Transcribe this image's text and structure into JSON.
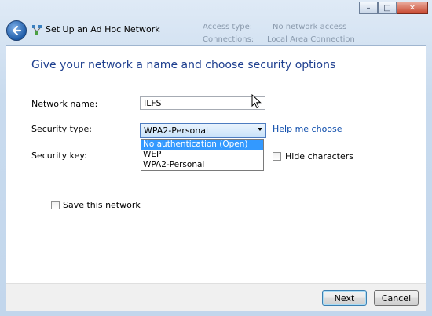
{
  "window": {
    "title": "Set Up an Ad Hoc Network",
    "background_fragments": [
      "Access type:",
      "No network access",
      "Connections:",
      "Local Area Connection"
    ],
    "controls": {
      "minimize": "–",
      "maximize": "□",
      "close": "✕"
    }
  },
  "page": {
    "heading": "Give your network a name and choose security options"
  },
  "form": {
    "network_name_label": "Network name:",
    "network_name_value": "ILFS",
    "security_type_label": "Security type:",
    "security_type_selected": "WPA2-Personal",
    "security_options": [
      "No authentication (Open)",
      "WEP",
      "WPA2-Personal"
    ],
    "highlighted_option_index": 0,
    "help_link": "Help me choose",
    "security_key_label": "Security key:",
    "hide_characters_label": "Hide characters",
    "hide_characters_checked": false,
    "save_network_label": "Save this network",
    "save_network_checked": false
  },
  "footer": {
    "next_label": "Next",
    "cancel_label": "Cancel"
  },
  "icons": {
    "back": "back-arrow-icon",
    "network": "network-icon",
    "cursor": "mouse-pointer-icon"
  }
}
